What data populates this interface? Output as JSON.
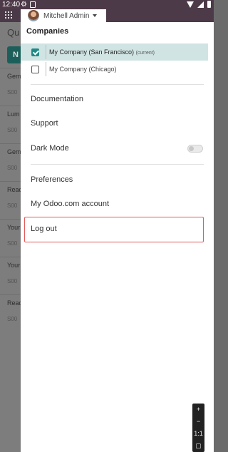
{
  "status_bar": {
    "time": "12:40"
  },
  "background": {
    "title": "Qu",
    "new_button": "N",
    "rows": [
      {
        "title": "Gem",
        "sub": "S00"
      },
      {
        "title": "Lum",
        "sub": "S00"
      },
      {
        "title": "Gem",
        "sub": "S00"
      },
      {
        "title": "Read",
        "sub": "S00"
      },
      {
        "title": "Your",
        "sub": "S00"
      },
      {
        "title": "Your",
        "sub": "S00"
      },
      {
        "title": "Read",
        "sub": "S00"
      }
    ]
  },
  "user": {
    "name": "Mitchell Admin"
  },
  "companies": {
    "heading": "Companies",
    "items": [
      {
        "name": "My Company (San Francisco)",
        "suffix": "(current)",
        "checked": true
      },
      {
        "name": "My Company (Chicago)",
        "suffix": "",
        "checked": false
      }
    ]
  },
  "menu": {
    "documentation": "Documentation",
    "support": "Support",
    "dark_mode": "Dark Mode",
    "preferences": "Preferences",
    "account": "My Odoo.com account",
    "logout": "Log out"
  },
  "zoom": {
    "plus": "+",
    "minus": "−",
    "ratio": "1:1"
  }
}
